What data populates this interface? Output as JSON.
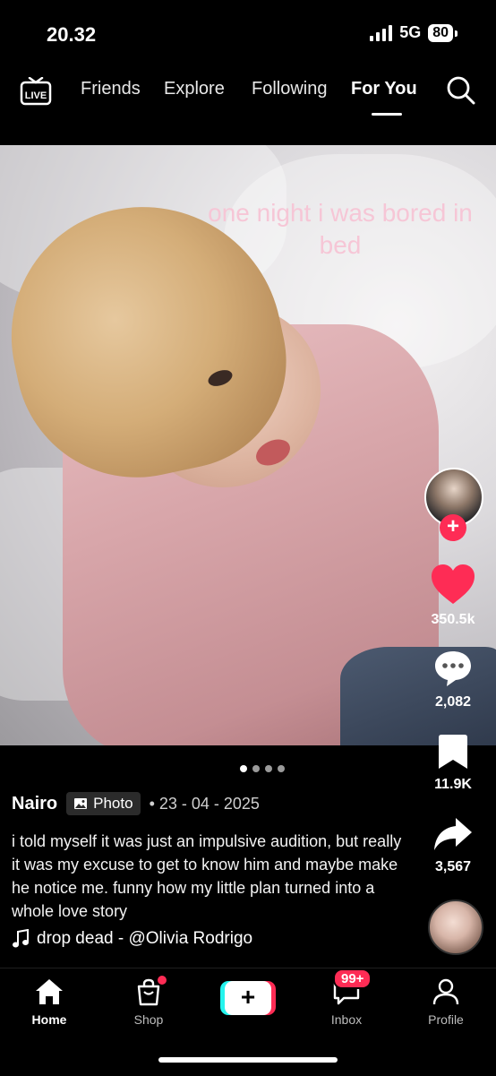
{
  "status_bar": {
    "time": "20.32",
    "network": "5G",
    "battery": "80"
  },
  "top_nav": {
    "live_label": "LIVE",
    "tabs": [
      {
        "label": "Friends"
      },
      {
        "label": "Explore"
      },
      {
        "label": "Following"
      },
      {
        "label": "For You",
        "active": true
      }
    ]
  },
  "post": {
    "overlay_text": "one night i was bored in bed",
    "author": "Nairo",
    "type_badge": "Photo",
    "date": "• 23 - 04 - 2025",
    "description": "i told myself it was just an impulsive audition, but really it was my excuse to get to know him and maybe make he notice me. funny how my little plan turned into a whole love story",
    "sound": "drop dead - @Olivia Rodrigo",
    "carousel": {
      "total": 4,
      "current": 1
    }
  },
  "actions": {
    "likes": "350.5k",
    "comments": "2,082",
    "bookmarks": "11.9K",
    "shares": "3,567",
    "follow_symbol": "+"
  },
  "bottom_nav": {
    "items": [
      {
        "label": "Home",
        "active": true
      },
      {
        "label": "Shop"
      },
      {
        "label": ""
      },
      {
        "label": "Inbox"
      },
      {
        "label": "Profile"
      }
    ],
    "inbox_badge": "99+",
    "create_symbol": "+"
  },
  "colors": {
    "accent": "#fe2c55",
    "cyan": "#25f4ee",
    "overlay_text": "#f6c6d6"
  }
}
